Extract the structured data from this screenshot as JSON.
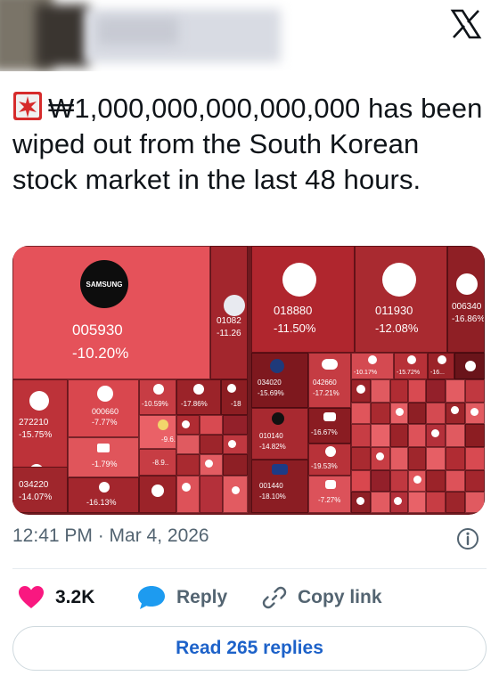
{
  "tweet": {
    "text": "₩1,000,000,000,000,000 has been wiped out from the South Korean stock market in the last 48 hours.",
    "timestamp": "12:41 PM · Mar 4, 2026"
  },
  "actions": {
    "likes": "3.2K",
    "reply_label": "Reply",
    "copy_label": "Copy link",
    "read_replies_label": "Read 265 replies"
  },
  "icons": {
    "brand": "x-logo-icon",
    "siren": "siren-emoji-icon",
    "like": "heart-icon",
    "reply": "reply-bubble-icon",
    "copy": "link-icon",
    "info": "info-icon"
  },
  "colors": {
    "heart": "#f91880",
    "reply": "#1d9bf0",
    "read_button_text": "#1d62c9",
    "tile_light": "#e5525a",
    "tile_mid": "#c5373e",
    "tile_dark": "#9a2229"
  },
  "heatmap": {
    "samsung_logo": "SAMSUNG",
    "tiles": [
      {
        "code": "005930",
        "pct": "-10.20%"
      },
      {
        "code": "01082",
        "pct": "-11.26"
      },
      {
        "code": "018880",
        "pct": "-11.50%"
      },
      {
        "code": "011930",
        "pct": "-12.08%"
      },
      {
        "code": "006340",
        "pct": "-16.86%"
      },
      {
        "code": "000660",
        "pct": "-7.77%"
      },
      {
        "code": "",
        "pct": "-10.59%"
      },
      {
        "code": "",
        "pct": "-17.86%"
      },
      {
        "code": "",
        "pct": "-18"
      },
      {
        "code": "272210",
        "pct": "-15.75%"
      },
      {
        "code": "034020",
        "pct": "-15.69%"
      },
      {
        "code": "042660",
        "pct": "-17.21%"
      },
      {
        "code": "",
        "pct": "-10.17%"
      },
      {
        "code": "",
        "pct": "-15.72%"
      },
      {
        "code": "",
        "pct": "-16..."
      },
      {
        "code": "",
        "pct": "-9.6.."
      },
      {
        "code": "",
        "pct": "-1.79%"
      },
      {
        "code": "",
        "pct": "-8.9.."
      },
      {
        "code": "010140",
        "pct": "-14.82%"
      },
      {
        "code": "",
        "pct": "-16.67%"
      },
      {
        "code": "034220",
        "pct": "-14.07%"
      },
      {
        "code": "",
        "pct": "-16.13%"
      },
      {
        "code": "",
        "pct": "-19.53%"
      },
      {
        "code": "001440",
        "pct": "-18.10%"
      },
      {
        "code": "",
        "pct": "-7.27%"
      }
    ]
  }
}
